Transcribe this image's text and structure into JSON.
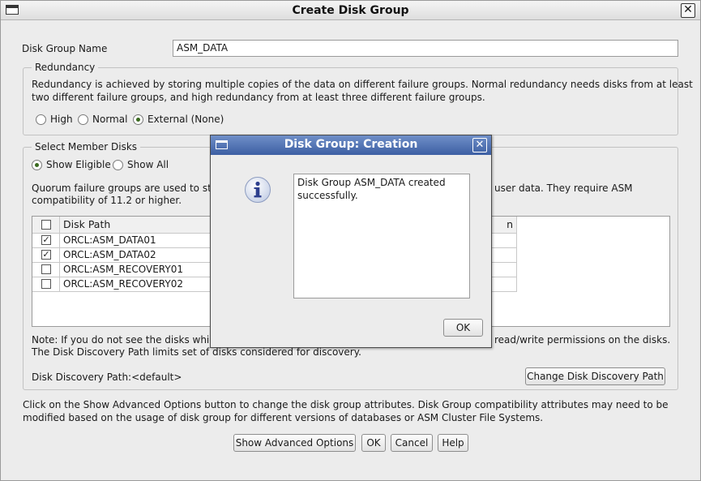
{
  "window": {
    "title": "Create Disk Group"
  },
  "disk_group_name": {
    "label": "Disk Group Name",
    "value": "ASM_DATA"
  },
  "redundancy": {
    "title": "Redundancy",
    "description_line1": "Redundancy is achieved by storing multiple copies of the data on different failure groups. Normal redundancy needs disks from at least",
    "description_line2": "two different failure groups, and high redundancy from at least three different failure groups.",
    "options": [
      {
        "label": "High",
        "selected": false
      },
      {
        "label": "Normal",
        "selected": false
      },
      {
        "label": "External (None)",
        "selected": true
      }
    ]
  },
  "member_disks": {
    "title": "Select Member Disks",
    "filters": [
      {
        "label": "Show Eligible",
        "selected": true
      },
      {
        "label": "Show All",
        "selected": false
      }
    ],
    "quorum_line1_left": "Quorum failure groups are used to sto",
    "quorum_line1_right": "user data. They require ASM",
    "quorum_line2": "compatibility of 11.2 or higher.",
    "table": {
      "columns": [
        "Disk Path",
        "n"
      ],
      "rows": [
        {
          "path": "ORCL:ASM_DATA01",
          "checked": true
        },
        {
          "path": "ORCL:ASM_DATA02",
          "checked": true
        },
        {
          "path": "ORCL:ASM_RECOVERY01",
          "checked": false
        },
        {
          "path": "ORCL:ASM_RECOVERY02",
          "checked": false
        }
      ]
    },
    "note_line1_left": "Note: If you do not see the disks which",
    "note_line1_right": "read/write permissions on the disks.",
    "note_line2": "The Disk Discovery Path limits set of disks considered for discovery.",
    "discovery_path": "Disk Discovery Path:<default>",
    "change_path_button": "Change Disk Discovery Path"
  },
  "advanced_note_line1": "Click on the Show Advanced Options button to change the disk group attributes. Disk Group compatibility attributes may need to be",
  "advanced_note_line2": "modified based on the usage of disk group for different versions of databases or ASM Cluster File Systems.",
  "buttons": {
    "advanced": "Show Advanced Options",
    "ok": "OK",
    "cancel": "Cancel",
    "help": "Help"
  },
  "dialog": {
    "title": "Disk Group: Creation",
    "message_line1": "Disk Group ASM_DATA created",
    "message_line2": "successfully.",
    "ok_button": "OK",
    "icon": "info-icon",
    "title_color": "#3d5fa3"
  }
}
